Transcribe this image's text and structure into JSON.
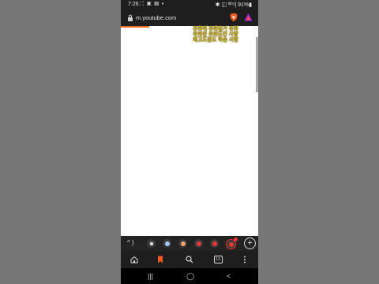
{
  "status_bar": {
    "time": "7:26",
    "left_icons": "⛶ ▣ ▤ •",
    "right_status": "✱ ◫ ᵂ⁵ˡ| 91%▮"
  },
  "address_bar": {
    "url": "m.youtube.com"
  },
  "page": {
    "overlay_lines": [
      "유화에 유화돌가 유화",
      "유화된 유화도면 사랑",
      "레고도움도 학습 사람"
    ]
  },
  "tab_strip": {
    "left_controls": "^ )",
    "tabs": [
      {
        "color": "#e0e0e0"
      },
      {
        "color": "#9ec7ff"
      },
      {
        "color": "#f5a36b"
      },
      {
        "color": "#e53935"
      },
      {
        "color": "#e53935"
      },
      {
        "color": "#e53935"
      }
    ],
    "new_tab_label": "+"
  },
  "toolbar": {
    "tab_count": "13"
  },
  "nav_bar": {
    "recents": "|||",
    "home": "◯",
    "back": "<"
  },
  "colors": {
    "background": "#777777",
    "browser_chrome": "#1e1e1e",
    "accent": "#f26c24",
    "brave_orange": "#f15a22"
  }
}
